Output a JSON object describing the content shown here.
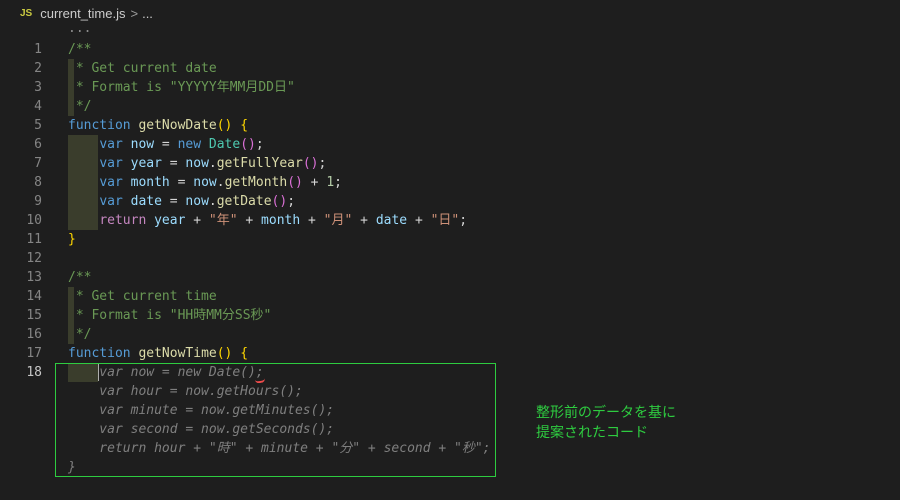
{
  "breadcrumb": {
    "file_icon_label": "JS",
    "file_name": "current_time.js",
    "separator": ">",
    "more": "..."
  },
  "folded_marker": "...",
  "lines": [
    {
      "n": "1",
      "parts": [
        [
          "/**",
          "cmt"
        ]
      ]
    },
    {
      "n": "2",
      "parts": [
        [
          " * Get current date",
          "cmt"
        ]
      ]
    },
    {
      "n": "3",
      "parts": [
        [
          " * Format is \"YYYYY年MM月DD日\"",
          "cmt"
        ]
      ]
    },
    {
      "n": "4",
      "parts": [
        [
          " */",
          "cmt"
        ]
      ]
    },
    {
      "n": "5",
      "parts": [
        [
          "function ",
          "kw"
        ],
        [
          "getNowDate",
          "fn"
        ],
        [
          "() ",
          "br1"
        ],
        [
          "{",
          "br1"
        ]
      ]
    },
    {
      "n": "6",
      "parts": [
        [
          "    ",
          ""
        ],
        [
          "var ",
          "kw"
        ],
        [
          "now",
          "var"
        ],
        [
          " = ",
          "pun"
        ],
        [
          "new ",
          "kw"
        ],
        [
          "Date",
          "cls"
        ],
        [
          "()",
          "br2"
        ],
        [
          ";",
          "pun"
        ]
      ]
    },
    {
      "n": "7",
      "parts": [
        [
          "    ",
          ""
        ],
        [
          "var ",
          "kw"
        ],
        [
          "year",
          "var"
        ],
        [
          " = ",
          "pun"
        ],
        [
          "now",
          "var"
        ],
        [
          ".",
          "pun"
        ],
        [
          "getFullYear",
          "fn"
        ],
        [
          "()",
          "br2"
        ],
        [
          ";",
          "pun"
        ]
      ]
    },
    {
      "n": "8",
      "parts": [
        [
          "    ",
          ""
        ],
        [
          "var ",
          "kw"
        ],
        [
          "month",
          "var"
        ],
        [
          " = ",
          "pun"
        ],
        [
          "now",
          "var"
        ],
        [
          ".",
          "pun"
        ],
        [
          "getMonth",
          "fn"
        ],
        [
          "()",
          "br2"
        ],
        [
          " + ",
          "pun"
        ],
        [
          "1",
          "num"
        ],
        [
          ";",
          "pun"
        ]
      ]
    },
    {
      "n": "9",
      "parts": [
        [
          "    ",
          ""
        ],
        [
          "var ",
          "kw"
        ],
        [
          "date",
          "var"
        ],
        [
          " = ",
          "pun"
        ],
        [
          "now",
          "var"
        ],
        [
          ".",
          "pun"
        ],
        [
          "getDate",
          "fn"
        ],
        [
          "()",
          "br2"
        ],
        [
          ";",
          "pun"
        ]
      ]
    },
    {
      "n": "10",
      "parts": [
        [
          "    ",
          ""
        ],
        [
          "return ",
          "kw2"
        ],
        [
          "year",
          "var"
        ],
        [
          " + ",
          "pun"
        ],
        [
          "\"年\"",
          "str"
        ],
        [
          " + ",
          "pun"
        ],
        [
          "month",
          "var"
        ],
        [
          " + ",
          "pun"
        ],
        [
          "\"月\"",
          "str"
        ],
        [
          " + ",
          "pun"
        ],
        [
          "date",
          "var"
        ],
        [
          " + ",
          "pun"
        ],
        [
          "\"日\"",
          "str"
        ],
        [
          ";",
          "pun"
        ]
      ]
    },
    {
      "n": "11",
      "parts": [
        [
          "}",
          "br1"
        ]
      ]
    },
    {
      "n": "12",
      "parts": []
    },
    {
      "n": "13",
      "parts": [
        [
          "/**",
          "cmt"
        ]
      ]
    },
    {
      "n": "14",
      "parts": [
        [
          " * Get current time",
          "cmt"
        ]
      ]
    },
    {
      "n": "15",
      "parts": [
        [
          " * Format is \"HH時MM分SS秒\"",
          "cmt"
        ]
      ]
    },
    {
      "n": "16",
      "parts": [
        [
          " */",
          "cmt"
        ]
      ]
    },
    {
      "n": "17",
      "parts": [
        [
          "function ",
          "kw"
        ],
        [
          "getNowTime",
          "fn"
        ],
        [
          "() ",
          "br1"
        ],
        [
          "{",
          "br1"
        ]
      ]
    },
    {
      "n": "18",
      "active": true,
      "parts": [
        [
          "    var now = new Date();",
          "ghost"
        ]
      ]
    },
    {
      "n": "",
      "parts": [
        [
          "    var hour = now.getHours();",
          "ghost"
        ]
      ]
    },
    {
      "n": "",
      "parts": [
        [
          "    var minute = now.getMinutes();",
          "ghost"
        ]
      ]
    },
    {
      "n": "",
      "parts": [
        [
          "    var second = now.getSeconds();",
          "ghost"
        ]
      ]
    },
    {
      "n": "",
      "parts": [
        [
          "    return hour + \"時\" + minute + \"分\" + second + \"秒\";",
          "ghost"
        ]
      ]
    },
    {
      "n": "",
      "parts": [
        [
          "}",
          "ghost"
        ]
      ]
    }
  ],
  "annotation": {
    "line1": "整形前のデータを基に",
    "line2": "提案されたコード"
  },
  "colors": {
    "annotation": "#2ecc40",
    "background": "#1e1e1e"
  }
}
